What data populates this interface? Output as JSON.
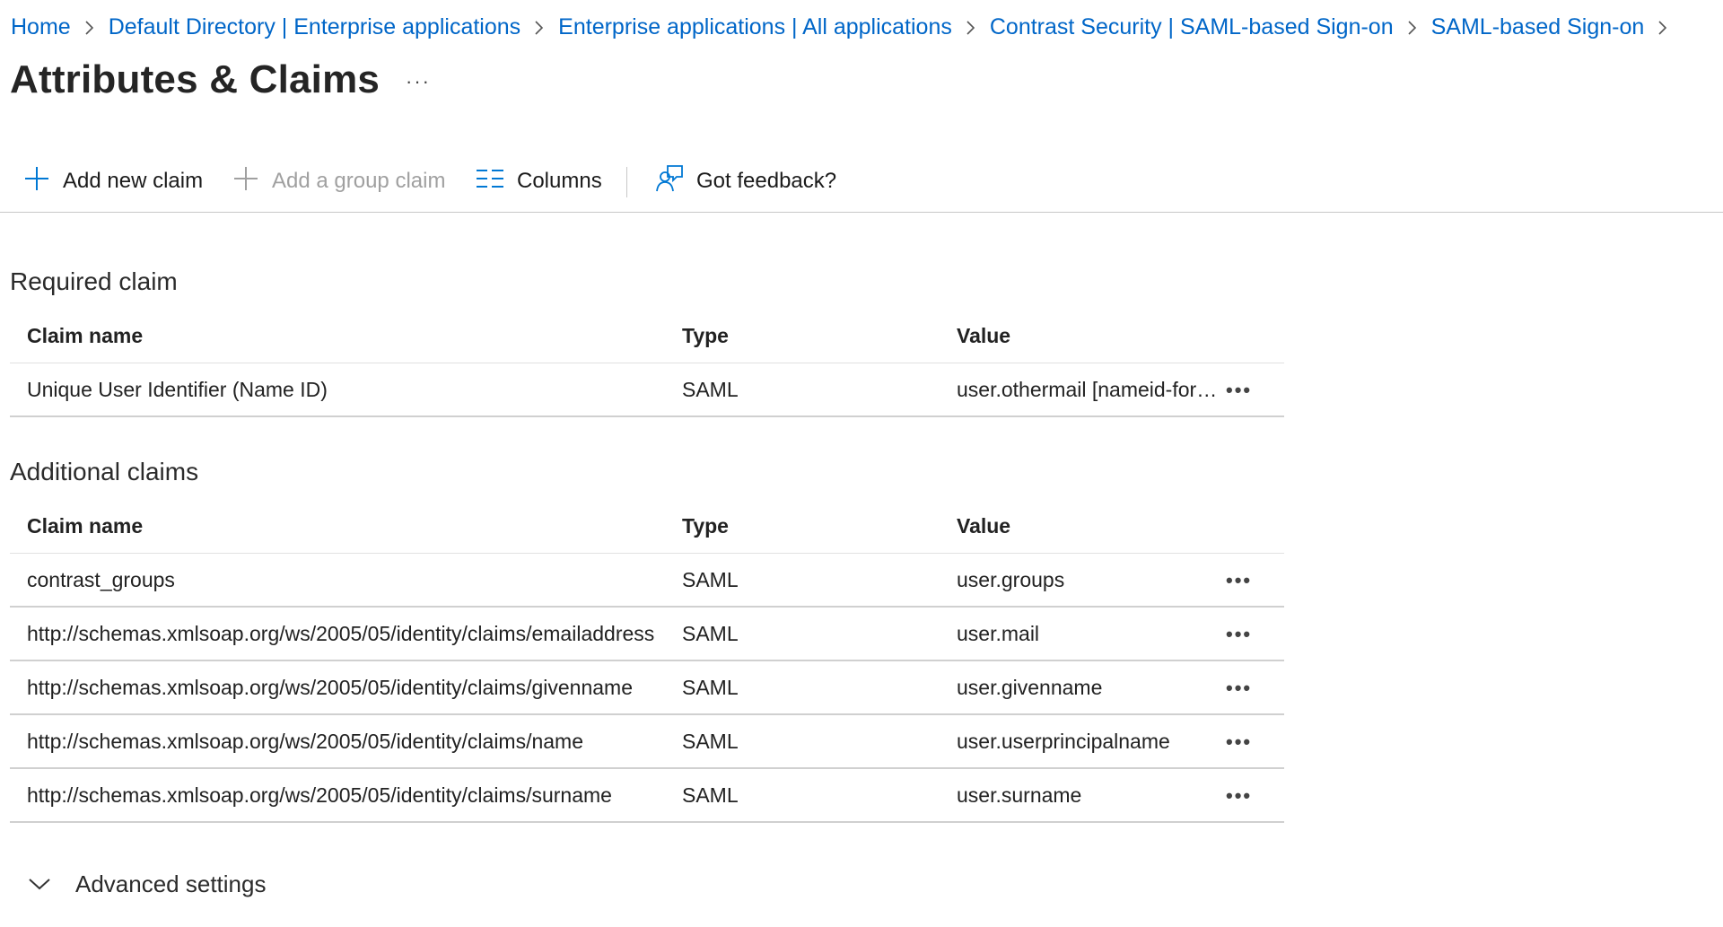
{
  "breadcrumb": [
    {
      "label": "Home"
    },
    {
      "label": "Default Directory | Enterprise applications"
    },
    {
      "label": "Enterprise applications | All applications"
    },
    {
      "label": "Contrast Security | SAML-based Sign-on"
    },
    {
      "label": "SAML-based Sign-on"
    }
  ],
  "page": {
    "title": "Attributes & Claims",
    "more": "···"
  },
  "toolbar": {
    "add_new_claim": "Add new claim",
    "add_group_claim": "Add a group claim",
    "columns": "Columns",
    "feedback": "Got feedback?"
  },
  "required": {
    "title": "Required claim",
    "headers": {
      "name": "Claim name",
      "type": "Type",
      "value": "Value"
    },
    "rows": [
      {
        "name": "Unique User Identifier (Name ID)",
        "type": "SAML",
        "value": "user.othermail [nameid-format:emailAddress]"
      }
    ]
  },
  "additional": {
    "title": "Additional claims",
    "headers": {
      "name": "Claim name",
      "type": "Type",
      "value": "Value"
    },
    "rows": [
      {
        "name": "contrast_groups",
        "type": "SAML",
        "value": "user.groups"
      },
      {
        "name": "http://schemas.xmlsoap.org/ws/2005/05/identity/claims/emailaddress",
        "type": "SAML",
        "value": "user.mail"
      },
      {
        "name": "http://schemas.xmlsoap.org/ws/2005/05/identity/claims/givenname",
        "type": "SAML",
        "value": "user.givenname"
      },
      {
        "name": "http://schemas.xmlsoap.org/ws/2005/05/identity/claims/name",
        "type": "SAML",
        "value": "user.userprincipalname"
      },
      {
        "name": "http://schemas.xmlsoap.org/ws/2005/05/identity/claims/surname",
        "type": "SAML",
        "value": "user.surname"
      }
    ]
  },
  "row_more": "•••",
  "advanced": {
    "label": "Advanced settings"
  },
  "colors": {
    "link": "#0066c8",
    "text": "#1b1b1b",
    "disabled": "#a0a0a0",
    "divider": "#d0d0d0"
  },
  "icons": [
    "chevron-right-icon",
    "plus-icon",
    "columns-icon",
    "feedback-icon",
    "chevron-down-icon",
    "more-icon"
  ]
}
